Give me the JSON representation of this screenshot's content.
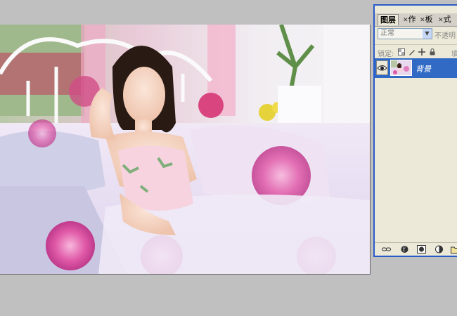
{
  "document": {
    "image_description_icon": "photo-canvas"
  },
  "layers_panel": {
    "tabs": [
      {
        "label": "图层",
        "active": true
      },
      {
        "label": "作",
        "active": false
      },
      {
        "label": "板",
        "active": false
      },
      {
        "label": "式",
        "active": false
      }
    ],
    "blend_mode": "正常",
    "opacity_label": "不透明",
    "lock_label": "锁定:",
    "fill_label": "填",
    "layers": [
      {
        "name": "背景",
        "visible": true,
        "selected": true
      }
    ],
    "footer_icons": [
      "link-layers-icon",
      "layer-style-icon",
      "add-mask-icon",
      "adjustment-layer-icon",
      "new-group-icon"
    ]
  },
  "colors": {
    "panel_bg": "#ece9d8",
    "selection": "#316ac5",
    "window_border": "#2a5cc9",
    "workspace": "#c0c0c0"
  }
}
